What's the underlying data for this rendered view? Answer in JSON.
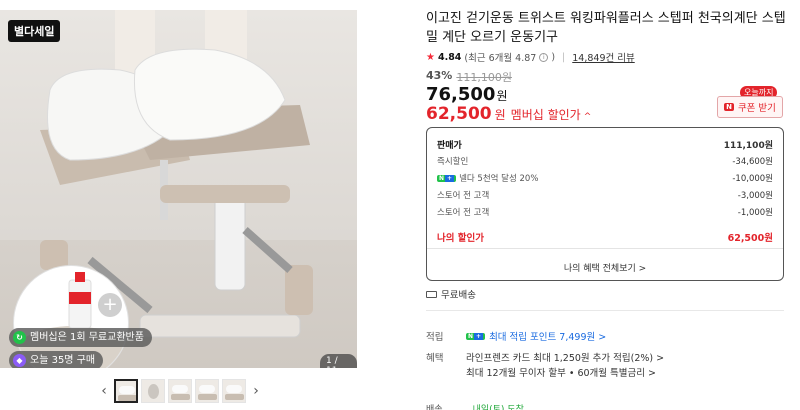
{
  "gallery": {
    "sale_badge": "별다세일",
    "page_counter": "1 / 11",
    "chips": {
      "exchange": "멤버십은 1회 무료교환반품",
      "buyers": "오늘 35명 구매"
    },
    "prev_arrow": "‹",
    "next_arrow": "›",
    "plus": "+"
  },
  "product": {
    "title": "이고진 걷기운동 트위스트 워킹파워플러스 스텝퍼 천국의계단 스텝밀 계단 오르기 운동기구",
    "rating_score": "4.84",
    "rating_recent": "(최근 6개월 4.87",
    "rating_close": ")",
    "reviews": "14,849건 리뷰",
    "discount_rate": "43%",
    "original_price": "111,100원",
    "price": "76,500",
    "price_unit": "원",
    "member_price": "62,500",
    "member_unit": "원",
    "member_label": "멤버십 할인가",
    "member_caret": "^",
    "coupon_tag": "오늘까지",
    "coupon_icon": "N",
    "coupon_label": "쿠폰 받기"
  },
  "breakdown": {
    "rows": [
      {
        "label": "판매가",
        "value": "111,100원"
      },
      {
        "label": "즉시할인",
        "value": "-34,600원"
      },
      {
        "label": "넬다 5천억 달성 20%",
        "value": "-10,000원"
      },
      {
        "label": "스토어 전 고객",
        "value": "-3,000원"
      },
      {
        "label": "스토어 전 고객",
        "value": "-1,000원"
      },
      {
        "label": "나의 할인가",
        "value": "62,500원"
      }
    ],
    "footer": "나의 혜택 전체보기 >"
  },
  "shipping": {
    "label": "무료배송"
  },
  "benefits": {
    "points_label": "적립",
    "points_text": "최대 적립 포인트 7,499원 >",
    "benefit_label": "혜택",
    "lines": [
      "라인프렌즈 카드 최대 1,250원 추가 적립(2%) >",
      "최대 12개월 무이자 할부 • 60개월 특별금리 >"
    ]
  },
  "cutoff": {
    "label": "배송",
    "text": "내일(토) 도착"
  },
  "colors": {
    "accent_red": "#e3242b",
    "naver_green": "#21c24a",
    "link_blue": "#1a6be0"
  }
}
